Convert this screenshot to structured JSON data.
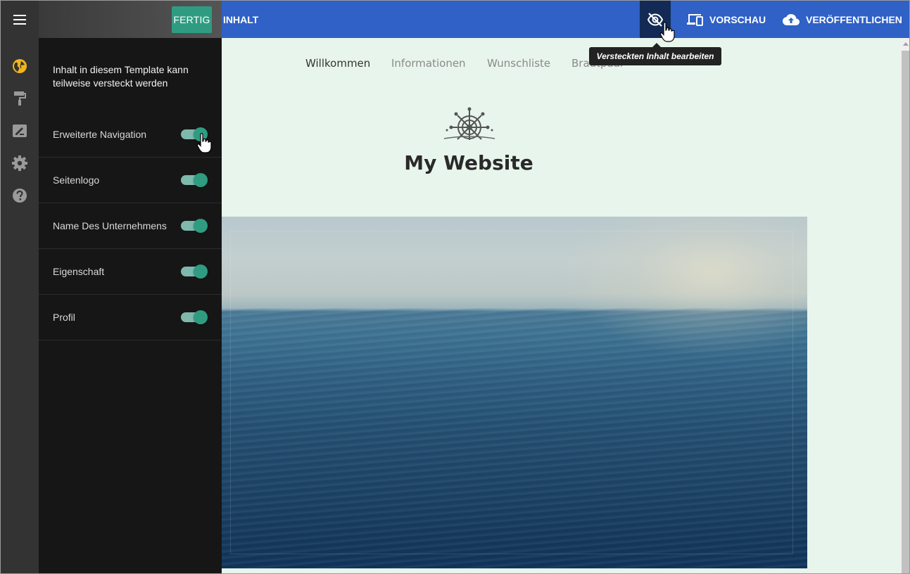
{
  "topbar": {
    "menu_icon": "hamburger-menu-icon",
    "done_label": "FERTIG",
    "content_label": "INHALT",
    "hide_icon": "eye-off-icon",
    "preview_label": "VORSCHAU",
    "preview_icon": "devices-icon",
    "publish_label": "VERÖFFENTLICHEN",
    "publish_icon": "cloud-upload-icon",
    "accent_color": "#2f61c6"
  },
  "tooltip": {
    "text": "Versteckten Inhalt bearbeiten"
  },
  "rail": {
    "items": [
      {
        "icon": "globe-icon",
        "color": "#f2b51a"
      },
      {
        "icon": "paint-roller-icon"
      },
      {
        "icon": "edit-note-icon"
      },
      {
        "icon": "gear-icon"
      },
      {
        "icon": "help-icon"
      }
    ]
  },
  "panel": {
    "intro": "Inhalt in diesem Template kann teilweise versteckt werden",
    "toggles": [
      {
        "label": "Erweiterte Navigation",
        "on": true
      },
      {
        "label": "Seitenlogo",
        "on": true
      },
      {
        "label": "Name Des Unternehmens",
        "on": true
      },
      {
        "label": "Eigenschaft",
        "on": true
      },
      {
        "label": "Profil",
        "on": true
      }
    ],
    "toggle_color": "#2f9c82"
  },
  "site": {
    "nav": [
      "Willkommen",
      "Informationen",
      "Wunschliste",
      "Brautpaar"
    ],
    "title": "My Website",
    "logo_icon": "ship-wheel-icon"
  }
}
